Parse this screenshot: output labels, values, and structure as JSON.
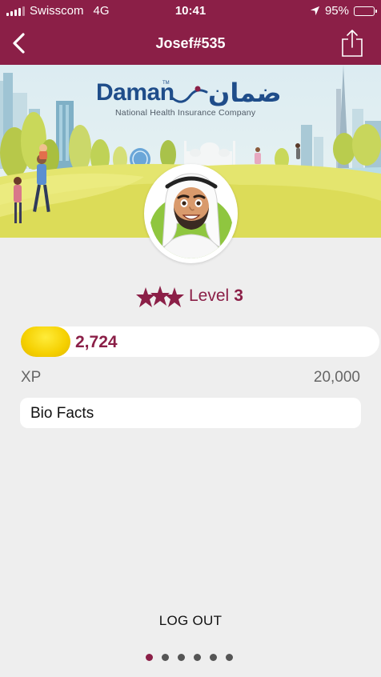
{
  "status": {
    "carrier": "Swisscom",
    "network": "4G",
    "time": "10:41",
    "battery": "95%",
    "battery_level": 0.95
  },
  "header": {
    "title": "Josef#535",
    "back_icon": "chevron-left-icon",
    "share_icon": "share-icon"
  },
  "banner": {
    "brand_en": "Daman",
    "brand_tm": "TM",
    "brand_ar": "ضمان",
    "tagline": "National Health Insurance Company"
  },
  "profile": {
    "level_label": "Level",
    "level": "3"
  },
  "xp": {
    "current": "2,724",
    "max": "20,000",
    "label": "XP",
    "progress": 0.1362
  },
  "bio": {
    "label": "Bio Facts"
  },
  "logout_label": "LOG OUT",
  "pager": {
    "count": 6,
    "active": 0
  },
  "colors": {
    "brand": "#8b1f47",
    "background": "#eeeeee",
    "xp_fill": "#f5d000",
    "logo_blue": "#1f4d8a"
  }
}
